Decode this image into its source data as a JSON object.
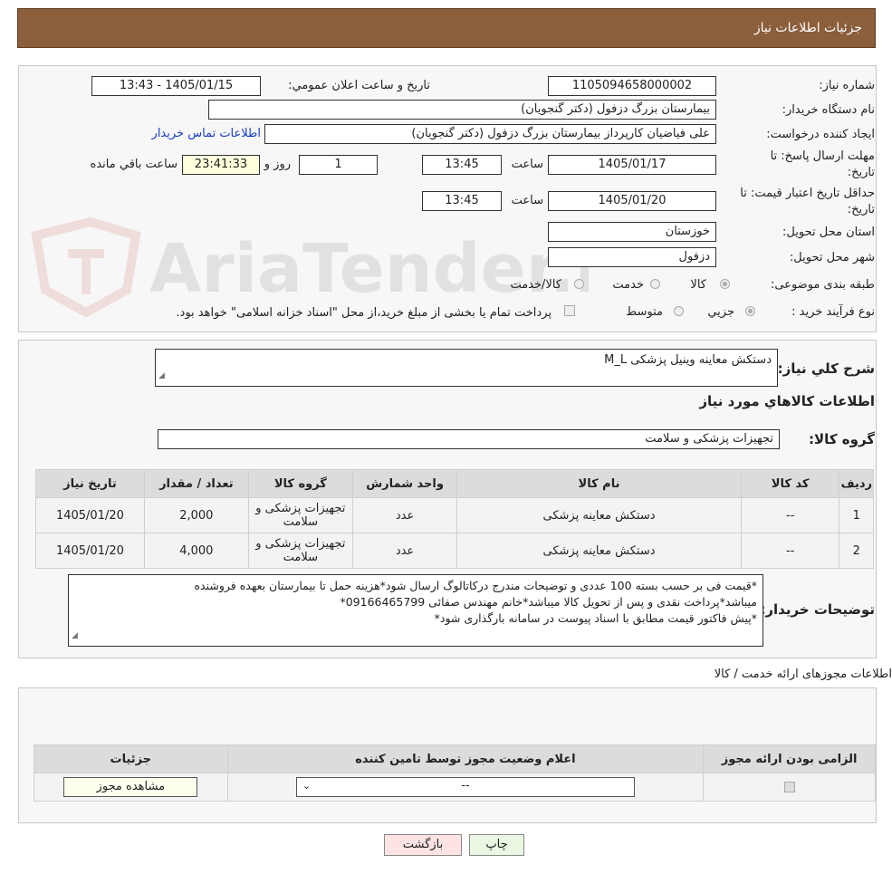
{
  "header": {
    "title": "جزئیات اطلاعات نیاز"
  },
  "watermark": {
    "text": "AriaTender.neT"
  },
  "form": {
    "need_number_label": "شماره نیاز:",
    "need_number": "1105094658000002",
    "announce_label": "تاریخ و ساعت اعلان عمومي:",
    "announce_value": "1405/01/15 - 13:43",
    "buyer_org_label": "نام دستگاه خریدار:",
    "buyer_org": "بیمارستان بزرگ دزفول (دکتر گنجویان)",
    "creator_label": "ایجاد کننده درخواست:",
    "creator": "علی فیاضیان کارپرداز بیمارستان بزرگ دزفول (دکتر گنجویان)",
    "contact_link": "اطلاعات تماس خریدار",
    "deadline_label_1": "مهلت ارسال پاسخ: تا",
    "deadline_label_2": "تاریخ:",
    "deadline_date": "1405/01/17",
    "time_label": "ساعت",
    "deadline_time": "13:45",
    "days_value": "1",
    "days_label": "روز و",
    "remaining_time": "23:41:33",
    "remaining_label": "ساعت باقي مانده",
    "validity_label_1": "حداقل تاریخ اعتبار قیمت: تا",
    "validity_label_2": "تاریخ:",
    "validity_date": "1405/01/20",
    "validity_time": "13:45",
    "province_label": "استان محل تحویل:",
    "province": "خوزستان",
    "city_label": "شهر محل تحویل:",
    "city": "دزفول",
    "category_label": "طبقه بندی موضوعی:",
    "category_options": [
      "کالا",
      "خدمت",
      "کالا/خدمت"
    ],
    "process_label": "نوع فرآیند خرید :",
    "process_options": [
      "جزیي",
      "متوسط"
    ],
    "payment_note": "پرداخت تمام یا بخشی از مبلغ خرید،از محل \"اسناد خزانه اسلامی\" خواهد بود."
  },
  "summary": {
    "desc_label": "شرح کلي نیاز:",
    "desc_value": "دستکش معاینه وینیل پزشکی M_L",
    "goods_title": "اطلاعات کالاهاي مورد نیاز",
    "group_label": "گروه کالا:",
    "group_value": "تجهیزات پزشکی و سلامت"
  },
  "items_table": {
    "headers": [
      "ردیف",
      "کد کالا",
      "نام کالا",
      "واحد شمارش",
      "گروه کالا",
      "تعداد / مقدار",
      "تاریخ نیاز"
    ],
    "rows": [
      [
        "1",
        "--",
        "دستکش معاینه پزشکی",
        "عدد",
        "تجهیزات پزشکی و سلامت",
        "2,000",
        "1405/01/20"
      ],
      [
        "2",
        "--",
        "دستکش معاینه پزشکی",
        "عدد",
        "تجهیزات پزشکی و سلامت",
        "4,000",
        "1405/01/20"
      ]
    ]
  },
  "buyer_notes": {
    "label": "توضیحات خریدار:",
    "line1": "*قیمت فی بر حسب بسته 100 عددی و توضیحات مندرج درکاتالوگ ارسال شود*هزینه حمل تا بیمارستان بعهده فروشنده",
    "line2": "میباشد*پرداخت نقدی و پس از تحویل کالا میباشد*خانم مهندس صفائی 09166465799*",
    "line3": "*پیش فاکتور قیمت مطابق با اسناد پیوست در سامانه بارگذاری شود*"
  },
  "license": {
    "title": "اطلاعات مجوزهای ارائه خدمت / کالا",
    "headers": [
      "الزامی بودن ارائه مجوز",
      "اعلام وضعیت مجوز توسط تامین کننده",
      "جزئیات"
    ],
    "select_value": "--",
    "view_button": "مشاهده مجوز"
  },
  "actions": {
    "print": "چاپ",
    "back": "بازگشت"
  },
  "colors": {
    "header_bg": "#8b5e3c",
    "link": "#1a3cc8",
    "back_btn": "#fde3e3",
    "print_btn": "#eaf7e2"
  }
}
